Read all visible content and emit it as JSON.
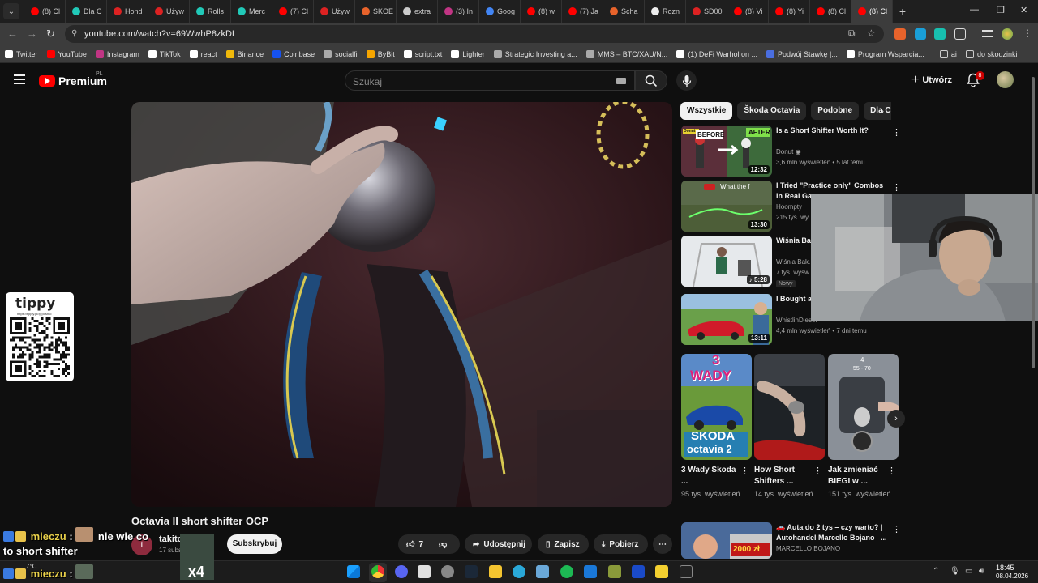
{
  "browser": {
    "tabs": [
      {
        "label": "(8) Cl",
        "color": "#ff0000"
      },
      {
        "label": "Dla C",
        "color": "#21c9b8"
      },
      {
        "label": "Hond",
        "color": "#d22"
      },
      {
        "label": "Używ",
        "color": "#d22"
      },
      {
        "label": "Rolls",
        "color": "#21c9b8"
      },
      {
        "label": "Merc",
        "color": "#21c9b8"
      },
      {
        "label": "(7) Cl",
        "color": "#ff0000"
      },
      {
        "label": "Używ",
        "color": "#d22"
      },
      {
        "label": "SKOE",
        "color": "#e8632b"
      },
      {
        "label": "extra",
        "color": "#ccc"
      },
      {
        "label": "(3) In",
        "color": "#c13584"
      },
      {
        "label": "Goog",
        "color": "#4285f4"
      },
      {
        "label": "(8) w",
        "color": "#ff0000"
      },
      {
        "label": "(7) Ja",
        "color": "#ff0000"
      },
      {
        "label": "Scha",
        "color": "#e8632b"
      },
      {
        "label": "Rozn",
        "color": "#eee"
      },
      {
        "label": "SD00",
        "color": "#d22"
      },
      {
        "label": "(8) Vi",
        "color": "#ff0000"
      },
      {
        "label": "(8) Yi",
        "color": "#ff0000"
      },
      {
        "label": "(8) Cl",
        "color": "#ff0000"
      },
      {
        "label": "(8) Cl",
        "color": "#ff0000"
      }
    ],
    "active_tab_close": "×",
    "new_tab": "+",
    "url": "youtube.com/watch?v=69WwhP8zkDI",
    "bookmarks": [
      {
        "label": "Twitter",
        "color": "#fff"
      },
      {
        "label": "YouTube",
        "color": "#ff0000"
      },
      {
        "label": "Instagram",
        "color": "#c13584"
      },
      {
        "label": "TikTok",
        "color": "#fff"
      },
      {
        "label": "react",
        "color": "#fff"
      },
      {
        "label": "Binance",
        "color": "#f0b90b"
      },
      {
        "label": "Coinbase",
        "color": "#1652f0"
      },
      {
        "label": "socialfi",
        "color": "#aaa"
      },
      {
        "label": "ByBit",
        "color": "#f7a600"
      },
      {
        "label": "script.txt",
        "color": "#fff"
      },
      {
        "label": "Lighter",
        "color": "#fff"
      },
      {
        "label": "Strategic Investing a...",
        "color": "#aaa"
      },
      {
        "label": "MMS – BTC/XAU/N...",
        "color": "#aaa"
      },
      {
        "label": "(1) DeFi Warhol on ...",
        "color": "#fff"
      },
      {
        "label": "Podwój Stawkę |...",
        "color": "#4a6ee0"
      },
      {
        "label": "Program Wsparcia...",
        "color": "#fff"
      }
    ],
    "bookmark_folders": [
      "ai",
      "do skodzinki"
    ]
  },
  "youtube": {
    "brand": "Premium",
    "region": "PL",
    "search_placeholder": "Szukaj",
    "create_label": "Utwórz",
    "notifications": "8"
  },
  "video": {
    "title": "Octavia II short shifter OCP",
    "channel": "takito",
    "channel_initial": "t",
    "subs": "17 subs",
    "subscribe": "Subskrybuj",
    "likes": "7",
    "share": "Udostępnij",
    "save": "Zapisz",
    "download": "Pobierz"
  },
  "chips": [
    "Wszystkie",
    "Škoda Octavia",
    "Podobne",
    "Dla C"
  ],
  "recommendations": [
    {
      "title": "Is a Short Shifter Worth It?",
      "channel": "Donut",
      "meta": "3,6 mln wyświetleń • 5 lat temu",
      "duration": "12:32",
      "badge_before": "BEFORE",
      "badge_after": "AFTER",
      "badge_brand": "Donut"
    },
    {
      "title": "I Tried \"Practice only\" Combos in Real Ga...",
      "channel": "Hoompty",
      "meta": "215 tys. wy...",
      "duration": "13:30",
      "overlay": "What the f"
    },
    {
      "title": "Wiśnia Ba... PRZERWY...",
      "channel": "Wiśnia Bak...",
      "meta": "7 tys. wyśw...",
      "duration": "5:28",
      "new": "Nowy"
    },
    {
      "title": "I Bought a... just to des...",
      "channel": "WhistlinDiesel",
      "meta": "4,4 mln wyświetleń • 7 dni temu",
      "duration": "13:11"
    }
  ],
  "shorts": [
    {
      "title": "3 Wady Skoda ...",
      "views": "95 tys. wyświetleń",
      "line1": "3",
      "line2": "WADY",
      "line3": "SKODA",
      "line4": "octavia 2"
    },
    {
      "title": "How Short Shifters ...",
      "views": "14 tys. wyświetleń"
    },
    {
      "title": "Jak zmieniać BIEGI w ...",
      "views": "151 tys. wyświetleń",
      "gear_text": "55 - 70",
      "gear_num": "4"
    }
  ],
  "last_rec": {
    "title": "Auta do 2 tys – czy warto? | Autohandel Marcello Bojano –...",
    "channel": "MARCELLO BOJANO",
    "price": "2000 zł"
  },
  "overlay": {
    "tippy_logo": "tippy",
    "tippy_url": "https://tipply.pl/@poshto",
    "chat": [
      {
        "user": "mieczu",
        "message": "nie wie co",
        "cont": "to short shifter"
      },
      {
        "user": "mieczu",
        "message": ""
      }
    ]
  },
  "taskbar": {
    "weather": "7°C",
    "time": "18:45",
    "date": "08.04.2026"
  }
}
